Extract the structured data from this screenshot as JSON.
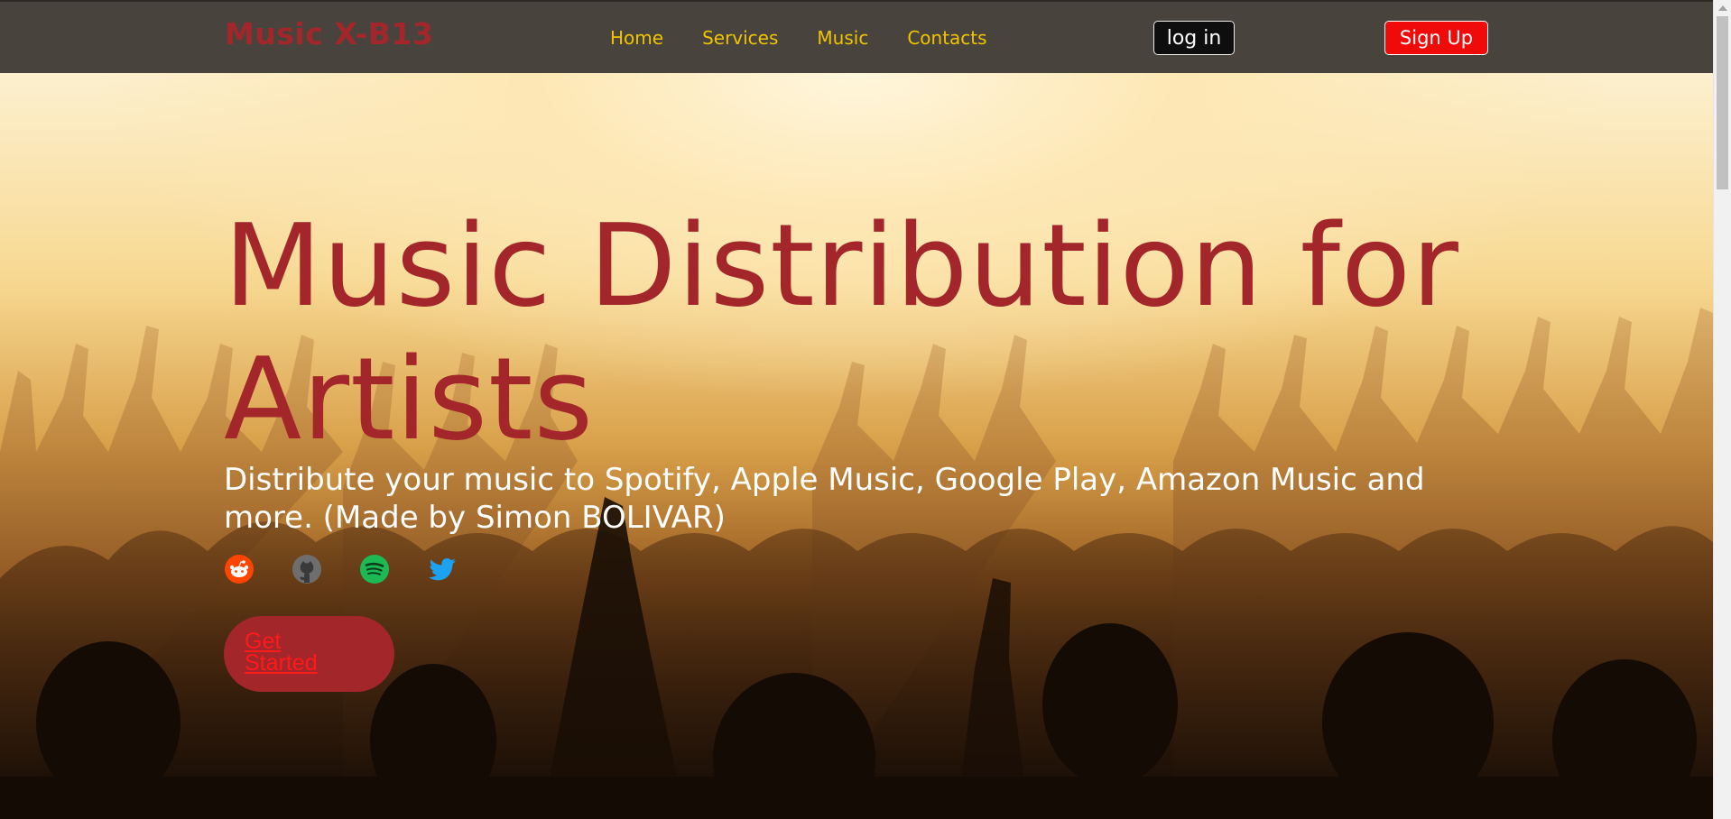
{
  "navbar": {
    "brand": "Music X-B13",
    "links": [
      "Home",
      "Services",
      "Music",
      "Contacts"
    ],
    "login_label": "log in",
    "signup_label": "Sign Up"
  },
  "hero": {
    "title": "Music Distribution for Artists",
    "subtitle": "Distribute your music to Spotify, Apple Music, Google Play, Amazon Music and more. (Made by Simon BOLIVAR)",
    "cta_label": "Get Started",
    "socials": [
      "reddit-icon",
      "github-icon",
      "spotify-icon",
      "twitter-icon"
    ]
  },
  "colors": {
    "accent": "#a3262b",
    "nav_bg": "#48443d",
    "nav_link": "#f0c400",
    "signup_bg": "#f00a0a",
    "reddit": "#ff4500",
    "github": "#6e6e6e",
    "spotify": "#1db954",
    "twitter": "#1da1f2"
  }
}
